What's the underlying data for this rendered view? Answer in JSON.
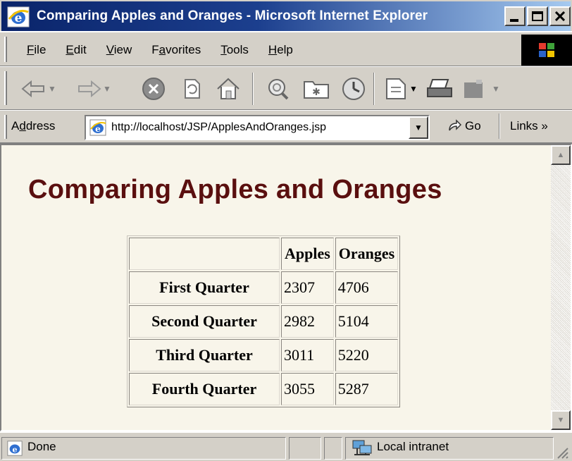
{
  "window": {
    "title": "Comparing Apples and Oranges - Microsoft Internet Explorer"
  },
  "menu": [
    {
      "label": "File",
      "accel": "F"
    },
    {
      "label": "Edit",
      "accel": "E"
    },
    {
      "label": "View",
      "accel": "V"
    },
    {
      "label": "Favorites",
      "accel": "a"
    },
    {
      "label": "Tools",
      "accel": "T"
    },
    {
      "label": "Help",
      "accel": "H"
    }
  ],
  "toolbar": {
    "icons": [
      "back-icon",
      "forward-icon",
      "stop-icon",
      "refresh-icon",
      "home-icon",
      "search-icon",
      "favorites-icon",
      "history-icon",
      "mail-icon",
      "print-icon",
      "edit-icon"
    ]
  },
  "address": {
    "label": "Address",
    "url": "http://localhost/JSP/ApplesAndOranges.jsp",
    "go": "Go",
    "links": "Links »"
  },
  "page": {
    "heading": "Comparing Apples and Oranges",
    "table": {
      "columns": [
        "",
        "Apples",
        "Oranges"
      ],
      "rows": [
        {
          "label": "First Quarter",
          "apples": "2307",
          "oranges": "4706"
        },
        {
          "label": "Second Quarter",
          "apples": "2982",
          "oranges": "5104"
        },
        {
          "label": "Third Quarter",
          "apples": "3011",
          "oranges": "5220"
        },
        {
          "label": "Fourth Quarter",
          "apples": "3055",
          "oranges": "5287"
        }
      ]
    }
  },
  "status": {
    "text": "Done",
    "zone": "Local intranet"
  },
  "colors": {
    "heading": "#5a0f0f",
    "page_background": "#f8f5ea",
    "titlebar": "#0a246a"
  }
}
